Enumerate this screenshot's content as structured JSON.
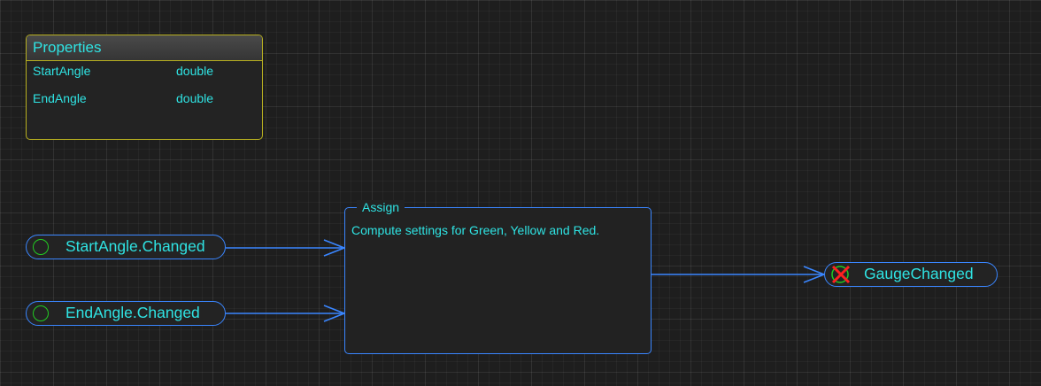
{
  "properties": {
    "title": "Properties",
    "items": [
      {
        "name": "StartAngle",
        "type": "double"
      },
      {
        "name": "EndAngle",
        "type": "double"
      }
    ]
  },
  "events": {
    "start": "StartAngle.Changed",
    "end": "EndAngle.Changed",
    "output": "GaugeChanged"
  },
  "assign": {
    "title": "Assign",
    "description": "Compute settings for Green, Yellow and Red."
  },
  "colors": {
    "text": "#2fe3e3",
    "node_border": "#3a86ff",
    "properties_border": "#b8b020",
    "trigger_ring": "#22cc22",
    "stop_cross": "#ff2020"
  }
}
